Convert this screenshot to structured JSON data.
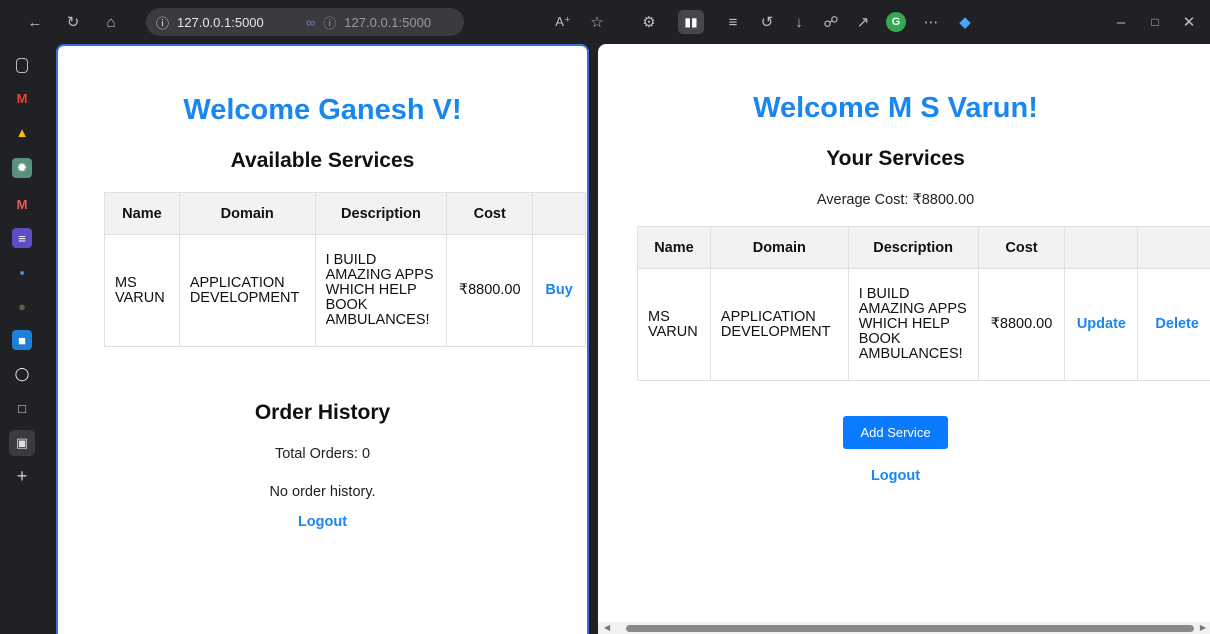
{
  "browser": {
    "url": "127.0.0.1:5000",
    "url_secondary": "127.0.0.1:5000",
    "colors": {
      "chrome_bg": "#202124",
      "accent": "#1a86f0",
      "button": "#0a7bff"
    }
  },
  "left": {
    "welcome": "Welcome Ganesh V!",
    "services_heading": "Available Services",
    "table": {
      "headers": [
        "Name",
        "Domain",
        "Description",
        "Cost",
        ""
      ],
      "rows": [
        {
          "name": "MS VARUN",
          "domain": "APPLICATION DEVELOPMENT",
          "description": "I BUILD AMAZING APPS WHICH HELP BOOK AMBULANCES!",
          "cost": "₹8800.00",
          "action": "Buy"
        }
      ]
    },
    "order_heading": "Order History",
    "total_orders": "Total Orders: 0",
    "no_history": "No order history.",
    "logout": "Logout"
  },
  "right": {
    "welcome": "Welcome M S Varun!",
    "services_heading": "Your Services",
    "average_cost": "Average Cost: ₹8800.00",
    "table": {
      "headers": [
        "Name",
        "Domain",
        "Description",
        "Cost",
        "",
        ""
      ],
      "rows": [
        {
          "name": "MS VARUN",
          "domain": "APPLICATION DEVELOPMENT",
          "description": "I BUILD AMAZING APPS WHICH HELP BOOK AMBULANCES!",
          "cost": "₹8800.00",
          "update": "Update",
          "delete": "Delete"
        }
      ]
    },
    "add_service": "Add Service",
    "logout": "Logout"
  }
}
